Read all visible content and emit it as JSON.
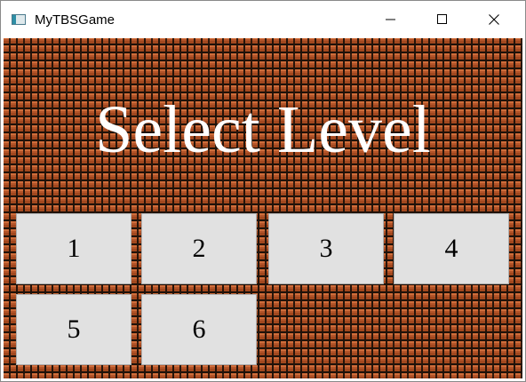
{
  "window": {
    "title": "MyTBSGame",
    "controls": {
      "minimize": "minimize-icon",
      "maximize": "maximize-icon",
      "close": "close-icon"
    }
  },
  "main": {
    "heading": "Select Level",
    "levels": [
      {
        "label": "1"
      },
      {
        "label": "2"
      },
      {
        "label": "3"
      },
      {
        "label": "4"
      },
      {
        "label": "5"
      },
      {
        "label": "6"
      }
    ]
  },
  "colors": {
    "brick": "#a8491e",
    "mortar": "#1e1109",
    "button_face": "#e1e1e1",
    "heading_text": "#ffffff"
  }
}
